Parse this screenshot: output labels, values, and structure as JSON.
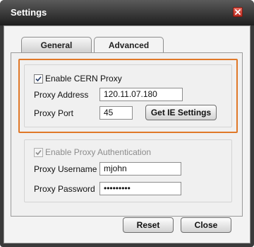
{
  "window": {
    "title": "Settings"
  },
  "tabs": [
    {
      "label": "General",
      "active": false
    },
    {
      "label": "Advanced",
      "active": true
    }
  ],
  "proxy": {
    "enable_label": "Enable CERN Proxy",
    "enabled": true,
    "address_label": "Proxy Address",
    "address_value": "120.11.07.180",
    "port_label": "Proxy Port",
    "port_value": "45",
    "ie_button": "Get IE Settings"
  },
  "auth": {
    "enable_label": "Enable Proxy Authentication",
    "enabled": true,
    "username_label": "Proxy Username",
    "username_value": "mjohn",
    "password_label": "Proxy Password",
    "password_value": "•••••••••"
  },
  "footer": {
    "reset_label": "Reset",
    "close_label": "Close"
  },
  "colors": {
    "highlight": "#e07828",
    "titlebar": "#2a2a2a",
    "close": "#c9382b"
  },
  "icons": {
    "close": "close-icon",
    "check": "checkmark-icon"
  }
}
